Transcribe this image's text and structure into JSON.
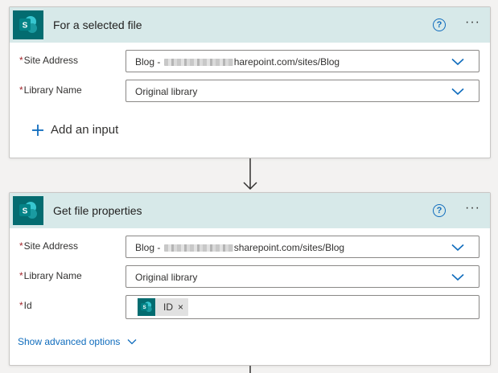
{
  "trigger": {
    "title": "For a selected file",
    "help_icon": "question-circle-icon",
    "more_icon": "more-horizontal-icon",
    "more_glyph": "···",
    "fields": {
      "site_address": {
        "label": "Site Address",
        "value_prefix": "Blog - ",
        "value_suffix": "harepoint.com/sites/Blog"
      },
      "library_name": {
        "label": "Library Name",
        "value": "Original library"
      }
    },
    "add_input_label": "Add an input"
  },
  "action": {
    "title": "Get file properties",
    "help_icon": "question-circle-icon",
    "more_icon": "more-horizontal-icon",
    "more_glyph": "···",
    "fields": {
      "site_address": {
        "label": "Site Address",
        "value_prefix": "Blog - ",
        "value_suffix": "sharepoint.com/sites/Blog"
      },
      "library_name": {
        "label": "Library Name",
        "value": "Original library"
      },
      "id": {
        "label": "Id",
        "token_text": "ID",
        "token_remove": "×"
      }
    },
    "advanced_label": "Show advanced options"
  },
  "required_marker": "*",
  "help_glyph": "?",
  "colors": {
    "sharepoint_teal": "#036c70",
    "header_bg": "#d7e9e9",
    "link_blue": "#0f6cbd",
    "required_red": "#a4262c"
  }
}
